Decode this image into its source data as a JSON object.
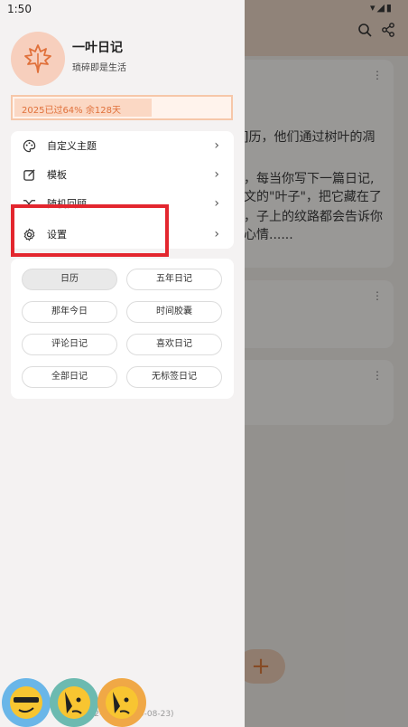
{
  "status_bar": {
    "time": "1:50",
    "icons": "▾◢▮"
  },
  "app": {
    "title": "一叶日记",
    "subtitle": "琐碎即是生活"
  },
  "year_progress": {
    "text": "2025已过64%  余128天",
    "percent": 64
  },
  "menu": [
    {
      "label": "自定义主题",
      "icon": "palette-icon"
    },
    {
      "label": "模板",
      "icon": "edit-box-icon"
    },
    {
      "label": "随机回顾",
      "icon": "shuffle-icon"
    },
    {
      "label": "设置",
      "icon": "gear-icon"
    }
  ],
  "pills": [
    {
      "label": "日历",
      "active": true
    },
    {
      "label": "五年日记"
    },
    {
      "label": "那年今日"
    },
    {
      "label": "时间胶囊"
    },
    {
      "label": "评论日记"
    },
    {
      "label": "喜欢日记"
    },
    {
      "label": "全部日记"
    },
    {
      "label": "无标签日记"
    }
  ],
  "version": "v2.12.2-153 (2025-08-23)",
  "background": {
    "text_line1": "]历，他们通过树叶的凋",
    "text_line2": "，每当你写下一篇日记,",
    "text_line3": "文的\"叶子\"，把它藏在了",
    "text_line4": "，子上的纹路都会告诉你",
    "text_line5": "心情......",
    "fab_label": "+"
  },
  "colors": {
    "accent": "#e0703a",
    "highlight": "#e3262e",
    "avatar_bg": "#f7cfbd"
  }
}
